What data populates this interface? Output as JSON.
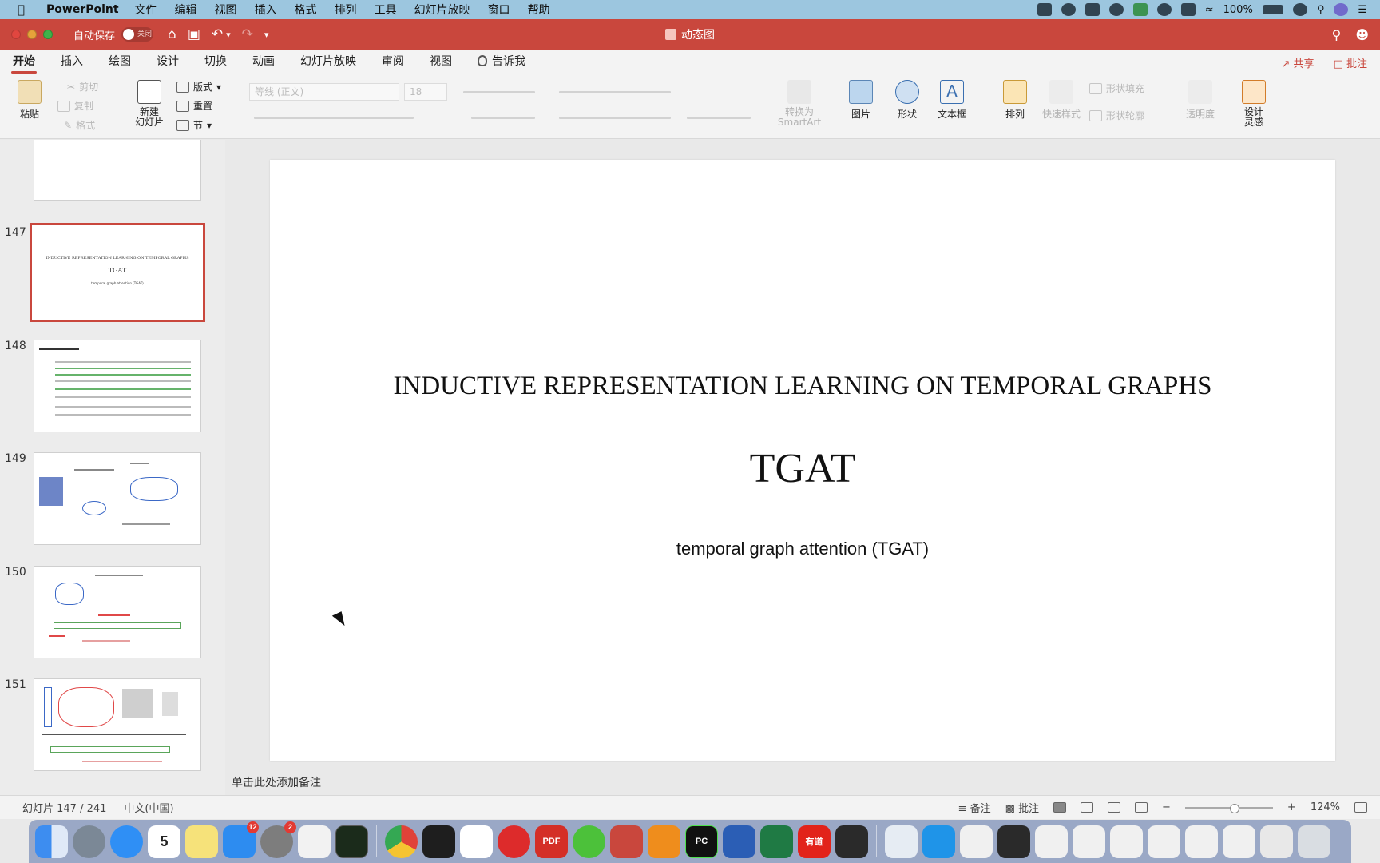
{
  "menubar": {
    "app": "PowerPoint",
    "items": [
      "文件",
      "编辑",
      "视图",
      "插入",
      "格式",
      "排列",
      "工具",
      "幻灯片放映",
      "窗口",
      "帮助"
    ],
    "battery": "100%"
  },
  "titlebar": {
    "autosave_label": "自动保存",
    "autosave_state": "关闭",
    "doc_title": "动态图"
  },
  "ribbon_tabs": {
    "tabs": [
      "开始",
      "插入",
      "绘图",
      "设计",
      "切换",
      "动画",
      "幻灯片放映",
      "审阅",
      "视图"
    ],
    "active": "开始",
    "tell_me": "告诉我",
    "share": "共享",
    "comments": "批注"
  },
  "ribbon": {
    "paste": "粘贴",
    "cut": "剪切",
    "copy": "复制",
    "format": "格式",
    "new_slide_line1": "新建",
    "new_slide_line2": "幻灯片",
    "layout": "版式",
    "reset": "重置",
    "section": "节",
    "font_name": "等线 (正文)",
    "font_size": "18",
    "convert_smartart_line1": "转换为",
    "convert_smartart_line2": "SmartArt",
    "picture": "图片",
    "shapes": "形状",
    "textbox": "文本框",
    "arrange": "排列",
    "quick_styles": "快速样式",
    "shape_fill": "形状填充",
    "shape_outline": "形状轮廓",
    "transparency": "透明度",
    "designer_line1": "设计",
    "designer_line2": "灵感"
  },
  "thumbnails": {
    "items": [
      {
        "number": "147",
        "selected": true,
        "title": "INDUCTIVE REPRESENTATION LEARNING ON TEMPORAL GRAPHS",
        "big": "TGAT",
        "sub": "temporal graph attention (TGAT)"
      },
      {
        "number": "148",
        "selected": false
      },
      {
        "number": "149",
        "selected": false
      },
      {
        "number": "150",
        "selected": false
      },
      {
        "number": "151",
        "selected": false
      }
    ]
  },
  "slide": {
    "title": "INDUCTIVE REPRESENTATION LEARNING ON TEMPORAL GRAPHS",
    "big": "TGAT",
    "subtitle": "temporal graph attention (TGAT)"
  },
  "notes_placeholder": "单击此处添加备注",
  "statusbar": {
    "slide_counter": "幻灯片 147 / 241",
    "language": "中文(中国)",
    "notes": "备注",
    "comments": "批注",
    "zoom": "124%"
  },
  "dock": {
    "calendar_day": "5",
    "appstore_badge": "12",
    "settings_badge": "2",
    "pdf_label": "PDF",
    "pycharm_label": "PC",
    "youdao_label": "有道"
  },
  "colors": {
    "accent": "#c9473d",
    "menubar": "#9cc6df"
  }
}
